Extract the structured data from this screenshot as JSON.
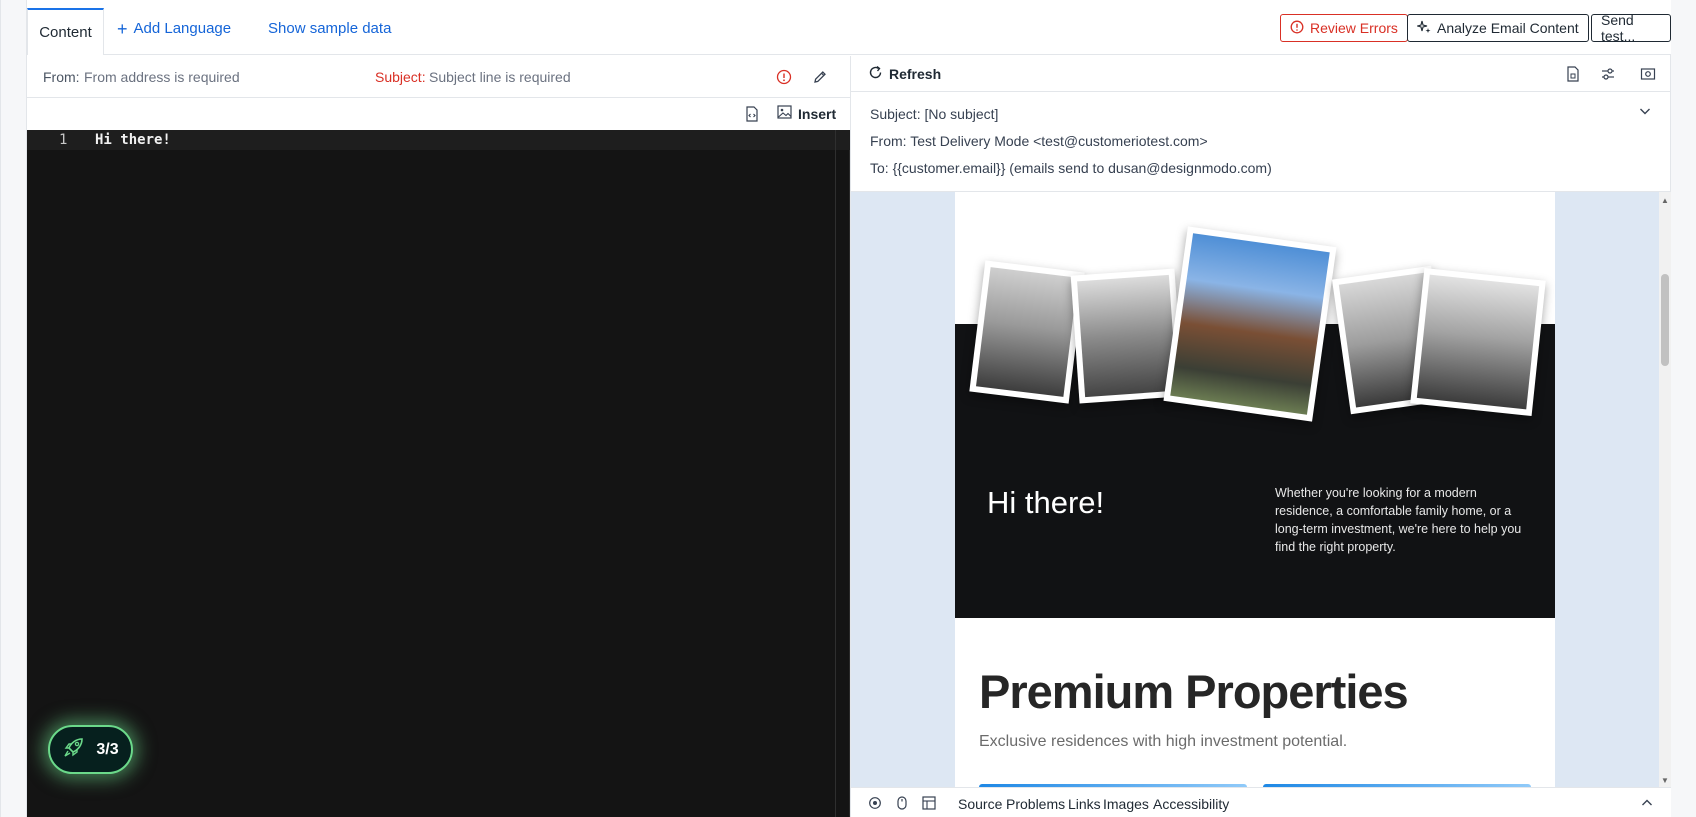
{
  "tabs": {
    "content_label": "Content",
    "add_language_label": "Add Language",
    "show_sample_label": "Show sample data"
  },
  "actions": {
    "review_errors_label": "Review Errors",
    "analyze_label": "Analyze Email Content",
    "send_test_label": "Send test..."
  },
  "fields": {
    "from_label": "From:",
    "from_placeholder": "From address is required",
    "subject_label": "Subject:",
    "subject_placeholder": "Subject line is required"
  },
  "editor": {
    "insert_label": "Insert",
    "lines": [
      {
        "number": "1",
        "text": "Hi there!"
      }
    ]
  },
  "badge": {
    "text": "3/3",
    "icon": "rocket-icon"
  },
  "preview": {
    "refresh_label": "Refresh",
    "subject_line": "Subject: [No subject]",
    "from_line": "From: Test Delivery Mode <test@customeriotest.com>",
    "to_line": "To: {{customer.email}} (emails send to dusan@designmodo.com)"
  },
  "email": {
    "hero_title": "Hi there!",
    "hero_copy": "Whether you're looking for a modern residence, a comfortable family home, or a long-term investment, we're here to help you find the right property.",
    "section_title": "Premium Properties",
    "section_subtitle": "Exclusive residences with high investment potential."
  },
  "bottom_tabs": [
    "Source",
    "Problems",
    "Links",
    "Images",
    "Accessibility"
  ],
  "colors": {
    "accent": "#1565d8",
    "error": "#d93025",
    "editor_bg": "#141414",
    "preview_bg": "#dde7f3",
    "badge_glow": "#6bd98a"
  }
}
